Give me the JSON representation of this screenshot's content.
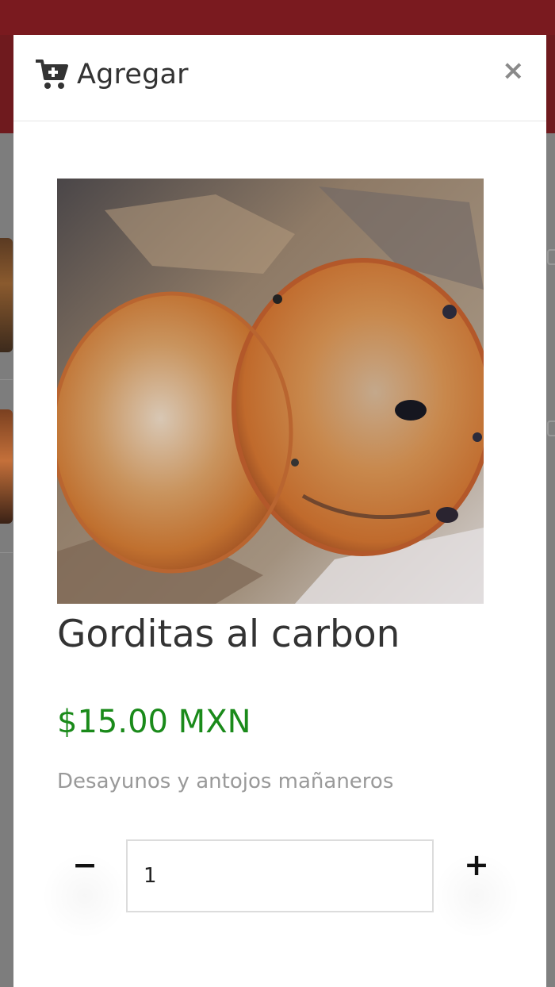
{
  "modal": {
    "title": "Agregar",
    "close_label": "×"
  },
  "product": {
    "name": "Gorditas al carbon",
    "price": "$15.00 MXN",
    "category": "Desayunos y antojos mañaneros"
  },
  "quantity": {
    "minus_label": "−",
    "plus_label": "+",
    "value": "1"
  },
  "colors": {
    "brand": "#7a1a1f",
    "price": "#1a8a1a"
  },
  "icons": {
    "title_icon": "cart-plus-icon",
    "close_icon": "close-icon"
  }
}
